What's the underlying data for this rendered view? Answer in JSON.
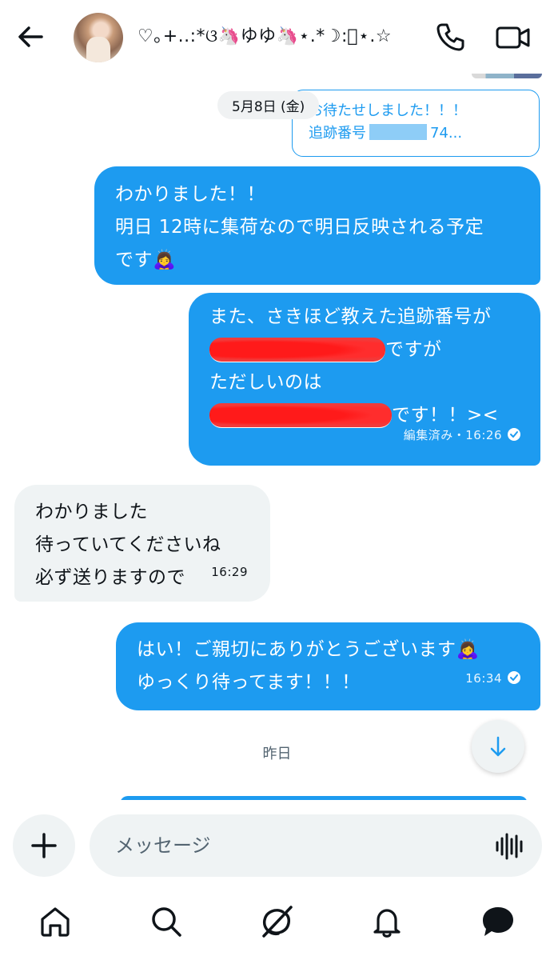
{
  "header": {
    "contact_name": "♡｡+..:*ଓ🦄ゆゆ🦄⋆.*☽:ﾟ⋆.☆"
  },
  "chat": {
    "date_separator": "5月8日 (金)",
    "reply_preview": {
      "line1": "お待たせしました！！！",
      "line2_prefix": "追跡番号",
      "line2_suffix": "74..."
    },
    "messages": [
      {
        "lines": [
          "わかりました！！",
          "明日 12時に集荷なので明日反映される予定",
          "です🙇‍♀️"
        ]
      },
      {
        "line1": "また、さきほど教えた追跡番号が",
        "line2_suffix": "ですが",
        "line3": "ただしいのは",
        "line4_suffix": "です！！><",
        "meta": "編集済み・16:26"
      },
      {
        "lines": [
          "わかりました",
          "待っていてくださいね",
          "必ず送りますので"
        ],
        "meta": "16:29"
      },
      {
        "lines": [
          "はい！ご親切にありがとうございます🙇‍♀️",
          "ゆっくり待ってます！！！"
        ],
        "meta": "16:34"
      }
    ],
    "day_label": "昨日"
  },
  "composer": {
    "placeholder": "メッセージ"
  },
  "colors": {
    "accent": "#1d9bf0",
    "incoming_bubble": "#eff3f4",
    "text_primary": "#0f1419",
    "text_secondary": "#536471"
  },
  "icons": {
    "back": "arrow-left-icon",
    "call": "phone-icon",
    "video": "video-camera-icon",
    "scroll": "arrow-down-icon",
    "add": "plus-icon",
    "voice": "waveform-icon",
    "nav": [
      "home-icon",
      "search-icon",
      "grok-icon",
      "bell-icon",
      "messages-icon"
    ]
  }
}
